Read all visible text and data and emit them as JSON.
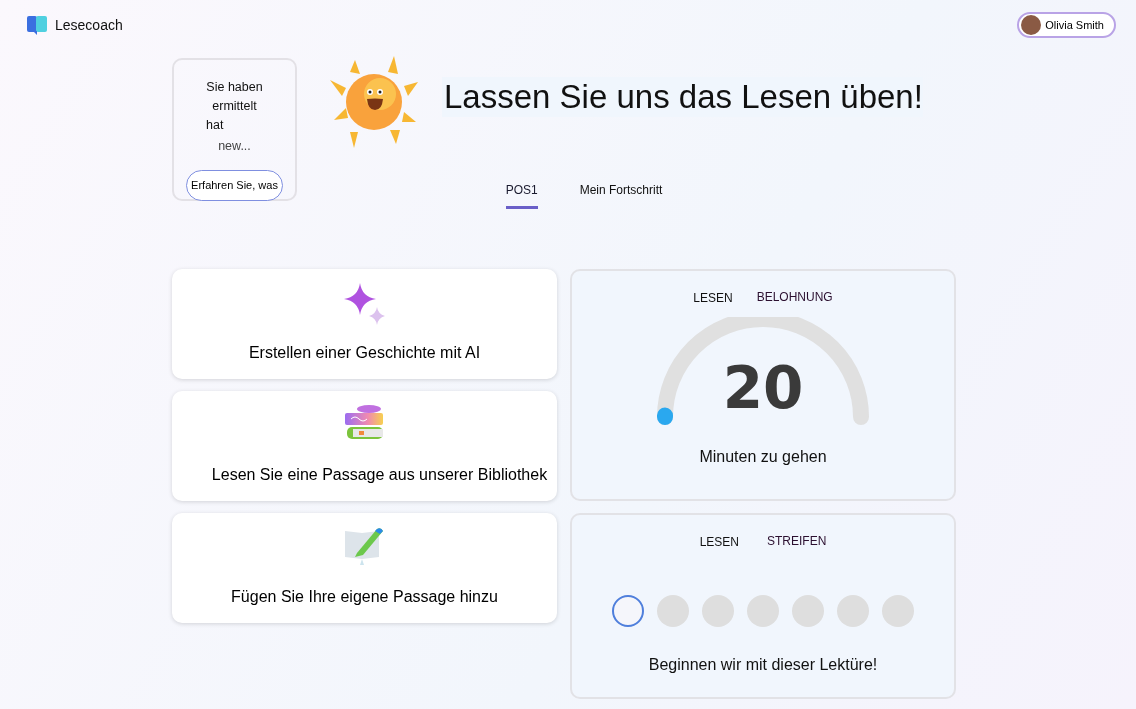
{
  "app": {
    "name": "Lesecoach"
  },
  "user": {
    "name": "Olivia Smith"
  },
  "promo": {
    "lines": [
      "Sie haben",
      "ermittelt",
      "hat",
      "new..."
    ],
    "button": "Erfahren Sie, was"
  },
  "title": "Lassen Sie uns das Lesen üben!",
  "tabs": [
    {
      "label": "POS1",
      "selected": true
    },
    {
      "label": "Mein Fortschritt",
      "selected": false
    }
  ],
  "actions": [
    {
      "kind": "sparkle",
      "label": "Erstellen einer Geschichte mit AI"
    },
    {
      "kind": "books",
      "label": "Lesen Sie eine Passage aus unserer Bibliothek"
    },
    {
      "kind": "pencil",
      "label": "Fügen Sie Ihre eigene Passage hinzu"
    }
  ],
  "goal": {
    "tabs": [
      {
        "label": "LESEN",
        "selected": true
      },
      {
        "label": "BELOHNUNG",
        "selected": false
      }
    ],
    "value": "20",
    "level": 0,
    "caption": "Minuten zu gehen"
  },
  "streak": {
    "tabs": [
      {
        "label": "LESEN",
        "selected": true
      },
      {
        "label": "STREIFEN",
        "selected": false
      }
    ],
    "days": [
      {
        "current": true
      },
      {
        "current": false
      },
      {
        "current": false
      },
      {
        "current": false
      },
      {
        "current": false
      },
      {
        "current": false
      },
      {
        "current": false
      }
    ],
    "message": "Beginnen wir mit dieser Lektüre!"
  }
}
